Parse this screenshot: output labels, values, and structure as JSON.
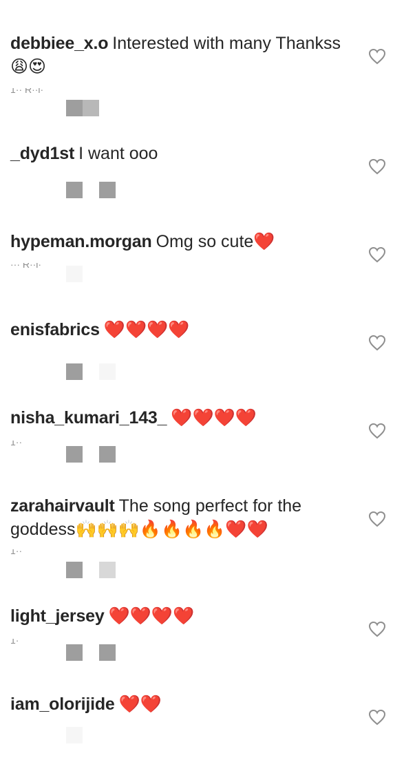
{
  "comments": [
    {
      "username": "debbiee_x.o",
      "text": "Interested with many Thankss",
      "emojis": "😩😍",
      "meta": "1·· R··l·"
    },
    {
      "username": "_dyd1st",
      "text": "I want ooo",
      "emojis": "",
      "meta": ""
    },
    {
      "username": "hypeman.morgan",
      "text": "Omg so cute",
      "emojis": "❤️",
      "meta": "··· R··l·"
    },
    {
      "username": "enisfabrics",
      "text": "",
      "emojis": "❤️❤️❤️❤️",
      "meta": ""
    },
    {
      "username": "nisha_kumari_143_",
      "text": "",
      "emojis": "❤️❤️❤️❤️",
      "meta": "1··"
    },
    {
      "username": "zarahairvault",
      "text": "The song perfect for the goddess",
      "emojis": "🙌🙌🙌🔥🔥🔥🔥❤️❤️",
      "meta": "1··"
    },
    {
      "username": "light_jersey",
      "text": "",
      "emojis": "❤️❤️❤️❤️",
      "meta": "1·"
    },
    {
      "username": "iam_olorijide",
      "text": "",
      "emojis": "❤️❤️",
      "meta": ""
    }
  ],
  "icons": {
    "like": "heart-outline-icon"
  },
  "colors": {
    "text": "#262626",
    "meta": "#8e8e8e",
    "heart_stroke": "#8e8e8e"
  }
}
